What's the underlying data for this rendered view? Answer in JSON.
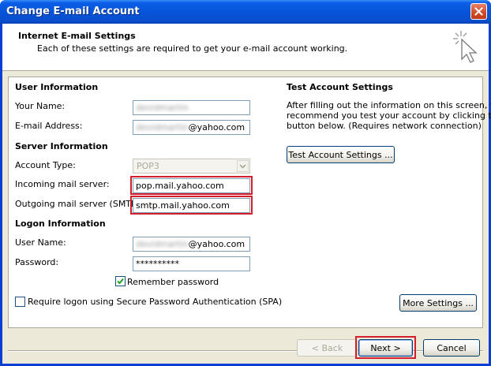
{
  "window": {
    "title": "Change E-mail Account"
  },
  "header": {
    "title": "Internet E-mail Settings",
    "subtitle": "Each of these settings are required to get your e-mail account working."
  },
  "user_info": {
    "heading": "User Information",
    "name_label": "Your Name:",
    "name_value": "devidmartin",
    "email_label": "E-mail Address:",
    "email_user": "devidmartin",
    "email_domain": "@yahoo.com"
  },
  "server_info": {
    "heading": "Server Information",
    "account_type_label": "Account Type:",
    "account_type_value": "POP3",
    "incoming_label": "Incoming mail server:",
    "incoming_value": "pop.mail.yahoo.com",
    "outgoing_label": "Outgoing mail server (SMTP):",
    "outgoing_value": "smtp.mail.yahoo.com"
  },
  "logon_info": {
    "heading": "Logon Information",
    "username_label": "User Name:",
    "username_user": "devidmartin",
    "username_domain": "@yahoo.com",
    "password_label": "Password:",
    "password_value": "**********",
    "remember_label": "Remember password",
    "remember_checked": true,
    "spa_label": "Require logon using Secure Password Authentication (SPA)",
    "spa_checked": false
  },
  "test_settings": {
    "heading": "Test Account Settings",
    "description_line1": "After filling out the information on this screen, we",
    "description_line2": "recommend you test your account by clicking the",
    "description_line3": "button below. (Requires network connection)",
    "test_button": "Test Account Settings ..."
  },
  "more_settings_button": "More Settings ...",
  "footer": {
    "back": "< Back",
    "next": "Next >",
    "cancel": "Cancel"
  },
  "colors": {
    "highlight": "#d21f2b",
    "titlebar": "#0654d8"
  }
}
